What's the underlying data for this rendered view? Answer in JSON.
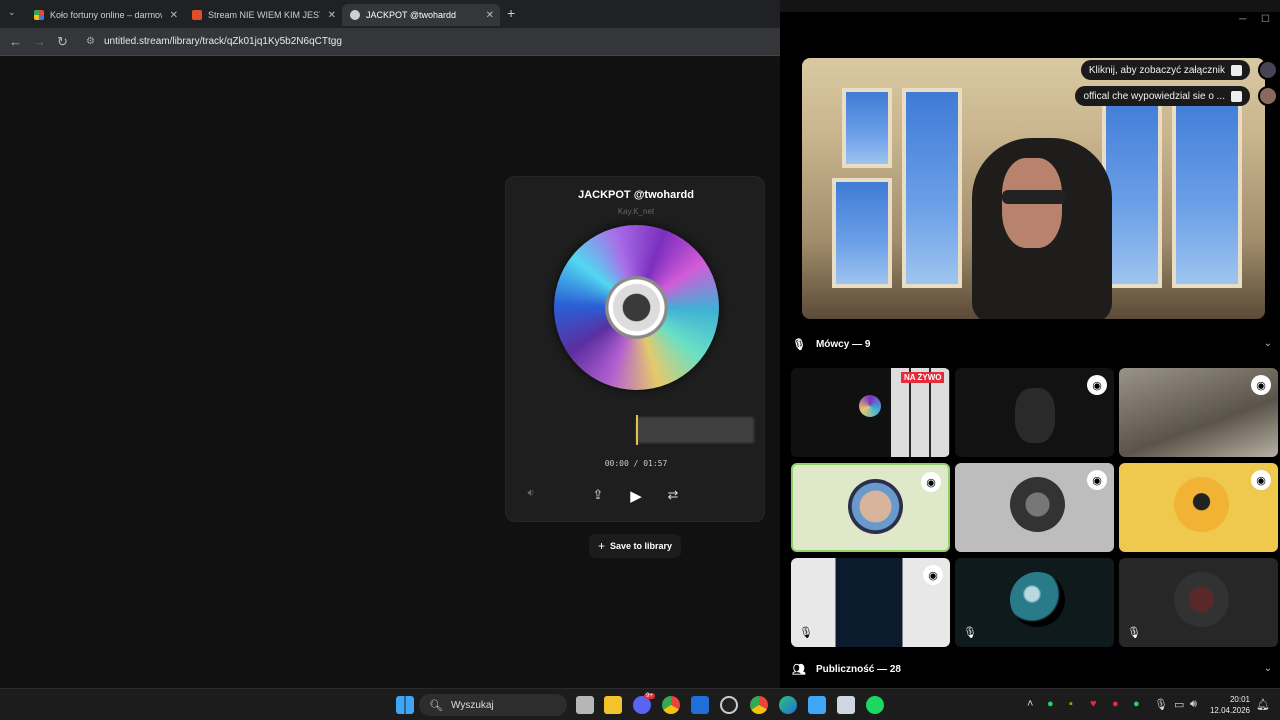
{
  "browser": {
    "tabs": [
      {
        "label": "Koło fortuny online – darmowe",
        "favicon_color": "#3b7de0"
      },
      {
        "label": "Stream NIE WIEM KIM JEST ON",
        "favicon_color": "#e14d2a"
      },
      {
        "label": "JACKPOT @twohardd",
        "favicon_color": "#cfcfcf"
      }
    ],
    "new_tab": "+",
    "url": "untitled.stream/library/track/qZk01jq1Ky5b2N6qCTtgg"
  },
  "player": {
    "title": "JACKPOT @twohardd",
    "artist": "Kay.K_net",
    "time": "00:00 / 01:57",
    "progress_fraction": 0,
    "save_label": "Save to library"
  },
  "discord": {
    "notifications": [
      {
        "text": "Kliknij, aby zobaczyć załącznik"
      },
      {
        "text": "offical che wypowiedzial sie o ..."
      }
    ],
    "speakers_label": "Mówcy — 9",
    "audience_label": "Publiczność — 28",
    "live_badge": "NA ŻYWO"
  },
  "taskbar": {
    "search_label": "Wyszukaj",
    "time": "20:01",
    "date": "12.04.2026",
    "notification_count": "9+"
  },
  "colors": {
    "accent_selected": "#c8e6a8",
    "live_red": "#e62b3c",
    "playhead": "#e6c24a"
  }
}
